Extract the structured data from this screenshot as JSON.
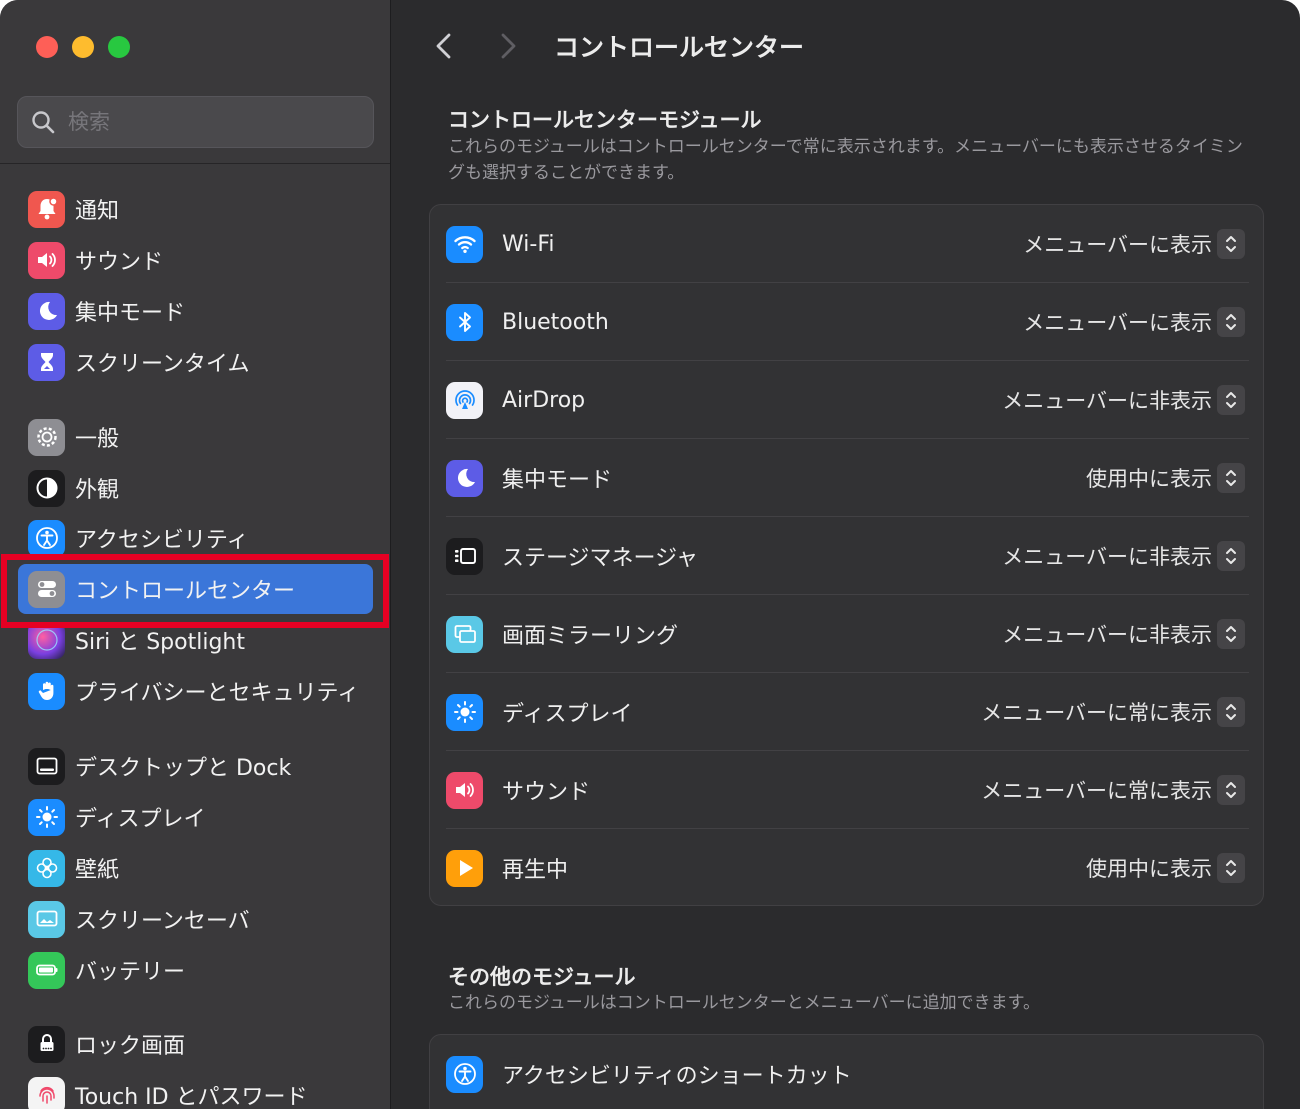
{
  "window": {
    "title": "コントロールセンター"
  },
  "search": {
    "placeholder": "検索"
  },
  "sidebar": {
    "items": [
      {
        "label": "通知",
        "icon": "bell-icon",
        "color": "#f0574f"
      },
      {
        "label": "サウンド",
        "icon": "speaker-icon",
        "color": "#ee4a6a"
      },
      {
        "label": "集中モード",
        "icon": "moon-icon",
        "color": "#5d5ce6"
      },
      {
        "label": "スクリーンタイム",
        "icon": "hourglass-icon",
        "color": "#5d5ce6"
      },
      {
        "label": "一般",
        "icon": "gear-icon",
        "color": "#8e8e93"
      },
      {
        "label": "外観",
        "icon": "appearance-icon",
        "color": "#1c1c1e"
      },
      {
        "label": "アクセシビリティ",
        "icon": "accessibility-icon",
        "color": "#1a8cff"
      },
      {
        "label": "コントロールセンター",
        "icon": "switches-icon",
        "color": "#8e8e93",
        "selected": true
      },
      {
        "label": "Siri と Spotlight",
        "icon": "siri-icon",
        "color": "#6b3fa0"
      },
      {
        "label": "プライバシーとセキュリティ",
        "icon": "hand-icon",
        "color": "#1a8cff"
      },
      {
        "label": "デスクトップと Dock",
        "icon": "dock-icon",
        "color": "#1c1c1e"
      },
      {
        "label": "ディスプレイ",
        "icon": "sun-icon",
        "color": "#1a8cff"
      },
      {
        "label": "壁紙",
        "icon": "flower-icon",
        "color": "#35b8e8"
      },
      {
        "label": "スクリーンセーバ",
        "icon": "screensaver-icon",
        "color": "#5ac8e6"
      },
      {
        "label": "バッテリー",
        "icon": "battery-icon",
        "color": "#34c759"
      },
      {
        "label": "ロック画面",
        "icon": "lock-icon",
        "color": "#1c1c1e"
      },
      {
        "label": "Touch ID とパスワード",
        "icon": "fingerprint-icon",
        "color": "#f4f4f4"
      }
    ]
  },
  "main": {
    "section1": {
      "title": "コントロールセンターモジュール",
      "desc": "これらのモジュールはコントロールセンターで常に表示されます。メニューバーにも表示させるタイミングも選択することができます。",
      "rows": [
        {
          "label": "Wi-Fi",
          "value": "メニューバーに表示",
          "icon": "wifi-icon",
          "color": "#1a8cff"
        },
        {
          "label": "Bluetooth",
          "value": "メニューバーに表示",
          "icon": "bluetooth-icon",
          "color": "#1a8cff"
        },
        {
          "label": "AirDrop",
          "value": "メニューバーに非表示",
          "icon": "airdrop-icon",
          "color": "#f2f2f7"
        },
        {
          "label": "集中モード",
          "value": "使用中に表示",
          "icon": "moon-icon",
          "color": "#5d5ce6"
        },
        {
          "label": "ステージマネージャ",
          "value": "メニューバーに非表示",
          "icon": "stage-manager-icon",
          "color": "#1c1c1e"
        },
        {
          "label": "画面ミラーリング",
          "value": "メニューバーに非表示",
          "icon": "screen-mirroring-icon",
          "color": "#5ac8e6"
        },
        {
          "label": "ディスプレイ",
          "value": "メニューバーに常に表示",
          "icon": "sun-icon",
          "color": "#1a8cff"
        },
        {
          "label": "サウンド",
          "value": "メニューバーに常に表示",
          "icon": "speaker-icon",
          "color": "#ee4a6a"
        },
        {
          "label": "再生中",
          "value": "使用中に表示",
          "icon": "play-icon",
          "color": "#ff9f0a"
        }
      ]
    },
    "section2": {
      "title": "その他のモジュール",
      "desc": "これらのモジュールはコントロールセンターとメニューバーに追加できます。",
      "rows": [
        {
          "label": "アクセシビリティのショートカット",
          "icon": "accessibility-icon",
          "color": "#1a8cff"
        }
      ]
    }
  }
}
